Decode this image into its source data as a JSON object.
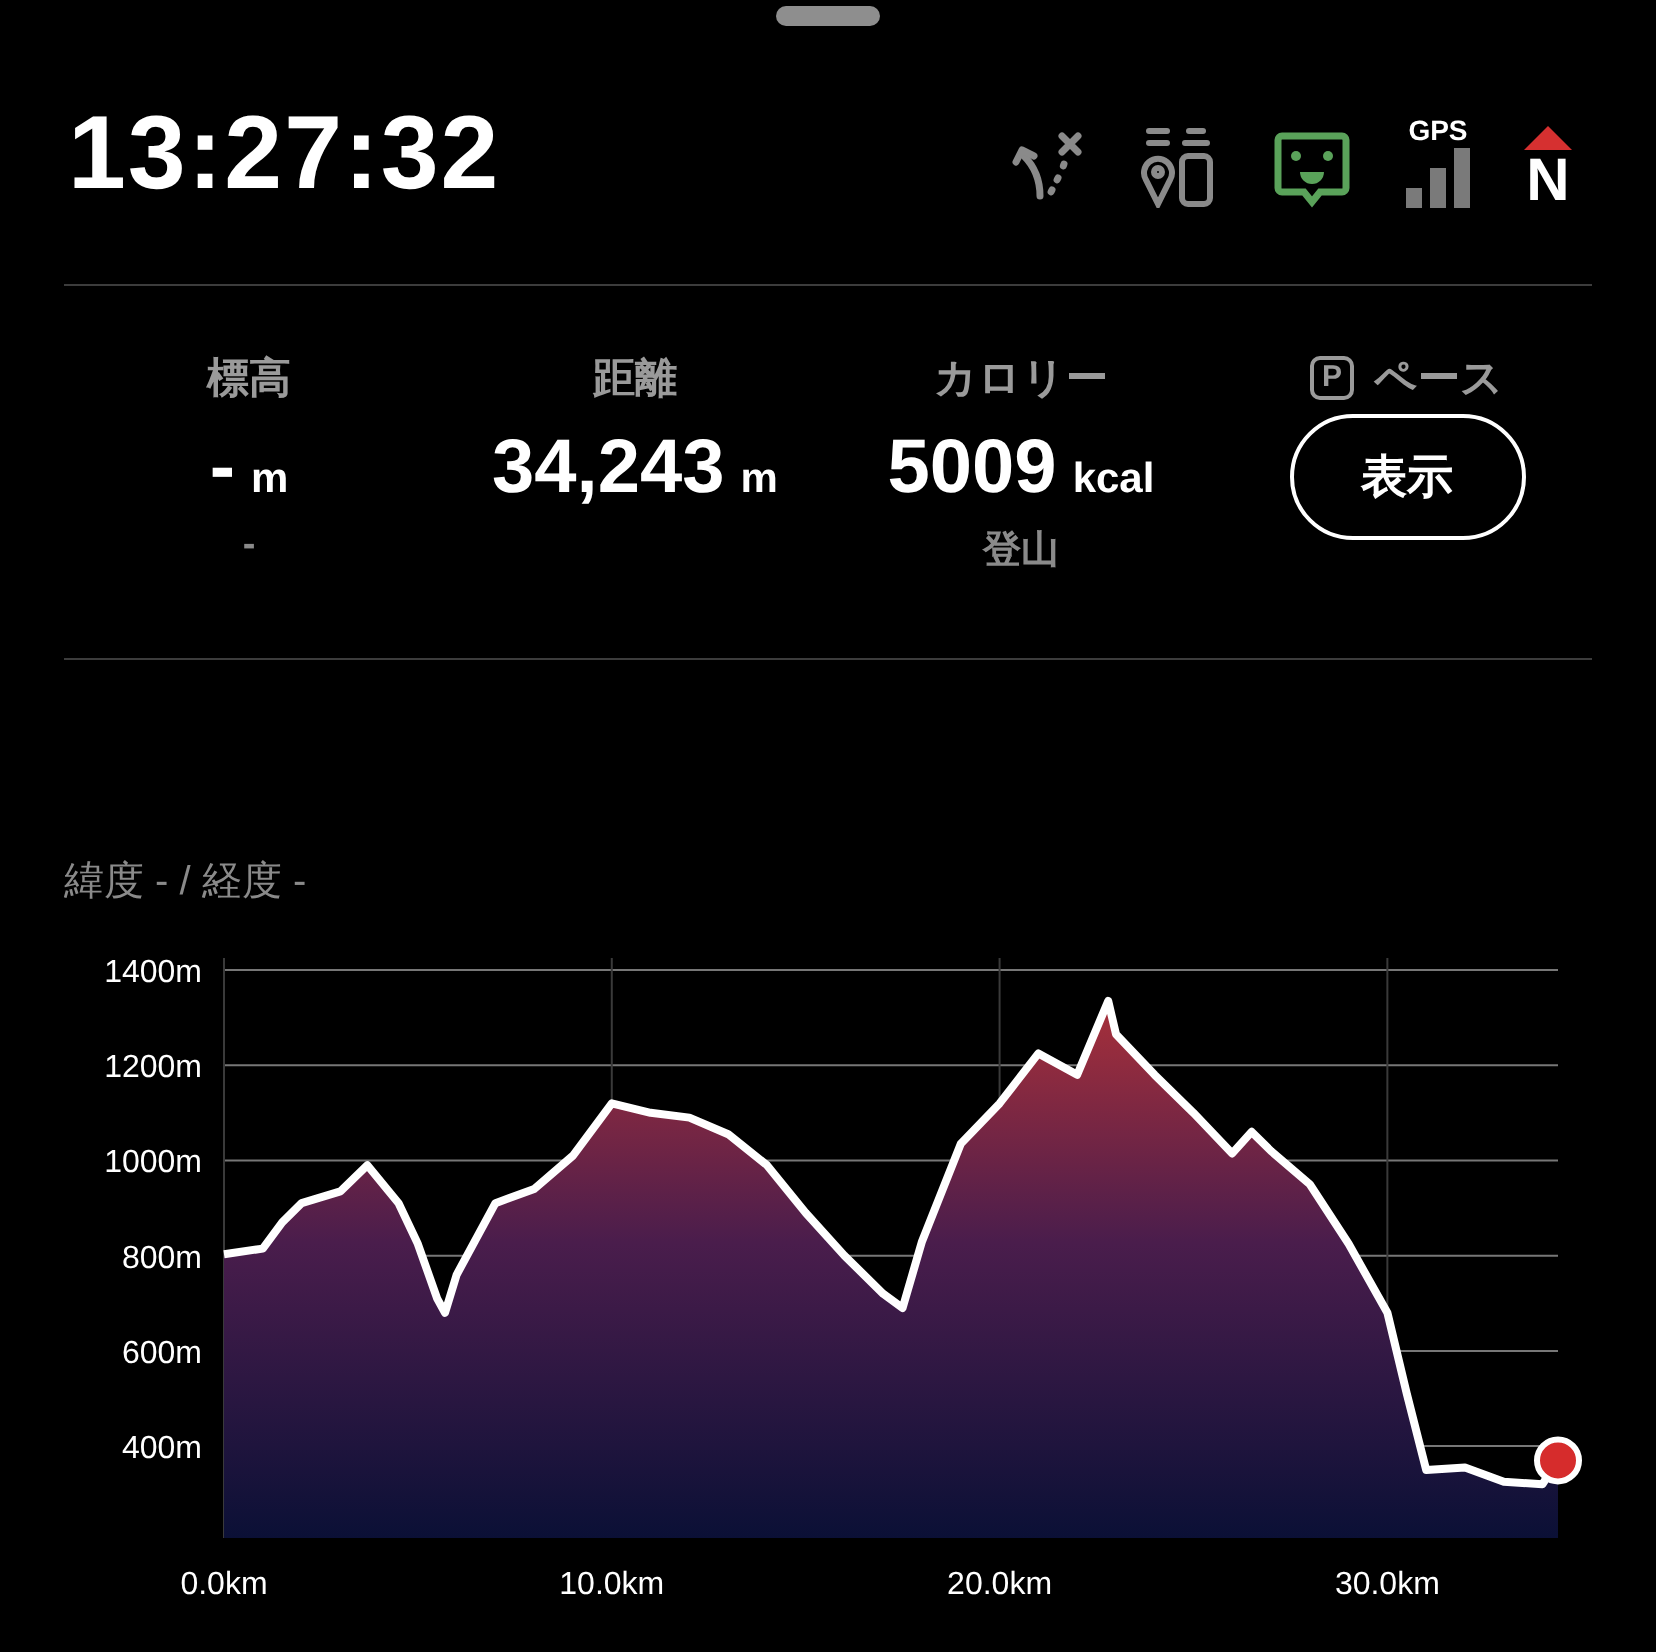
{
  "header": {
    "time": "13:27:32",
    "gps_label": "GPS",
    "compass_label": "N"
  },
  "stats": [
    {
      "label": "標高",
      "value": "-",
      "unit": "m",
      "sub": "-"
    },
    {
      "label": "距離",
      "value": "34,243",
      "unit": "m"
    },
    {
      "label": "カロリー",
      "value": "5009",
      "unit": "kcal",
      "sub": "登山"
    }
  ],
  "pace": {
    "icon_letter": "P",
    "label": "ペース",
    "button": "表示"
  },
  "coordinates": "緯度 - / 経度 -",
  "chart": {
    "chart_data": {
      "type": "area",
      "grid": true,
      "ylim": [
        207,
        1400
      ],
      "xlim": [
        0,
        34.4
      ],
      "yticks": [
        {
          "value": 400,
          "label": "400m"
        },
        {
          "value": 600,
          "label": "600m"
        },
        {
          "value": 800,
          "label": "800m"
        },
        {
          "value": 1000,
          "label": "1000m"
        },
        {
          "value": 1200,
          "label": "1200m"
        },
        {
          "value": 1400,
          "label": "1400m"
        }
      ],
      "xticks": [
        {
          "value": 0,
          "label": "0.0km"
        },
        {
          "value": 10,
          "label": "10.0km"
        },
        {
          "value": 20,
          "label": "20.0km"
        },
        {
          "value": 30,
          "label": "30.0km"
        }
      ],
      "x": [
        0,
        1,
        1.5,
        2,
        3,
        3.7,
        4.5,
        5,
        5.5,
        5.7,
        6,
        7,
        8,
        9,
        10,
        11,
        12,
        13,
        14,
        15,
        16,
        17,
        17.5,
        18,
        19,
        20,
        21,
        22,
        22.8,
        23,
        24,
        25,
        26,
        26.5,
        27,
        28,
        29,
        30,
        30.5,
        31,
        32,
        33,
        34,
        34.4
      ],
      "series": [
        {
          "color": "#ffffff",
          "values": [
            803,
            815,
            870,
            910,
            935,
            990,
            910,
            825,
            710,
            680,
            760,
            910,
            940,
            1010,
            1120,
            1100,
            1090,
            1055,
            990,
            890,
            800,
            720,
            690,
            830,
            1035,
            1120,
            1225,
            1180,
            1335,
            1265,
            1180,
            1100,
            1015,
            1060,
            1020,
            950,
            825,
            680,
            510,
            350,
            355,
            325,
            320,
            370
          ]
        }
      ]
    }
  }
}
